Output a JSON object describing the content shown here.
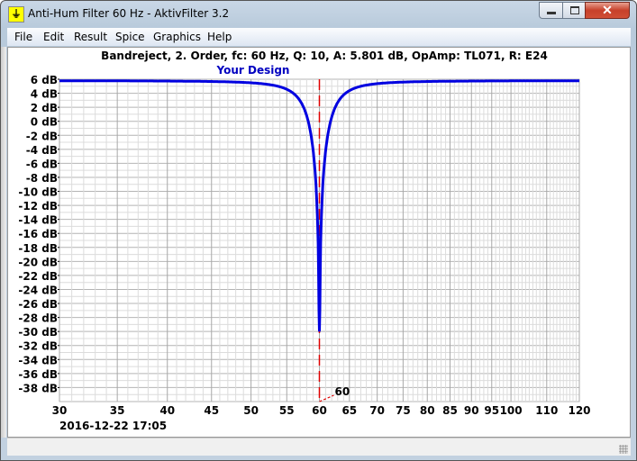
{
  "window": {
    "title": "Anti-Hum Filter 60 Hz - AktivFilter 3.2",
    "controls": {
      "minimize": "minimize",
      "maximize": "maximize",
      "close": "✕"
    }
  },
  "menu": [
    "File",
    "Edit",
    "Result",
    "Spice",
    "Graphics",
    "Help"
  ],
  "status": {
    "timestamp": "2016-12-22 17:05"
  },
  "chart_data": {
    "type": "line",
    "title": "Bandreject, 2. Order, fc: 60 Hz, Q: 10, A: 5.801 dB, OpAmp: TL071, R: E24",
    "subtitle": "Your Design",
    "xlabel": "",
    "ylabel": "",
    "xscale": "log",
    "xlim": [
      30,
      120
    ],
    "ylim": [
      -40,
      6
    ],
    "grid": true,
    "x_ticks": [
      30,
      35,
      40,
      45,
      50,
      55,
      60,
      65,
      70,
      75,
      80,
      85,
      90,
      95,
      100,
      110,
      120
    ],
    "y_ticks": [
      6,
      4,
      2,
      0,
      -2,
      -4,
      -6,
      -8,
      -10,
      -12,
      -14,
      -16,
      -18,
      -20,
      -22,
      -24,
      -26,
      -28,
      -30,
      -32,
      -34,
      -36,
      -38
    ],
    "y_tick_suffix": " dB",
    "marker": {
      "x": 60,
      "label": "60",
      "color": "#e00000"
    },
    "series": [
      {
        "name": "Your Design",
        "color": "#0000e0",
        "gain_db": 5.801,
        "fc": 60,
        "q": 10,
        "min_db": -30
      }
    ]
  }
}
